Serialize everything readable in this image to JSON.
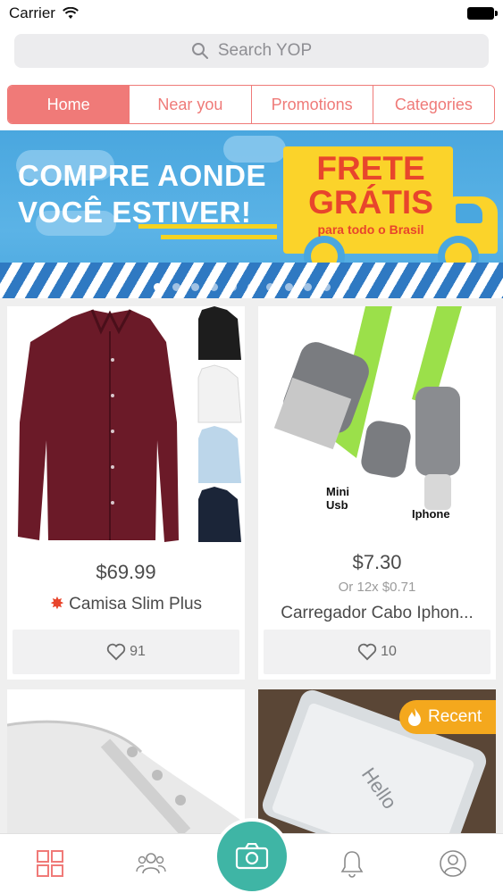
{
  "status_bar": {
    "carrier": "Carrier"
  },
  "search": {
    "placeholder": "Search YOP"
  },
  "tabs": [
    {
      "label": "Home",
      "active": true
    },
    {
      "label": "Near you",
      "active": false
    },
    {
      "label": "Promotions",
      "active": false
    },
    {
      "label": "Categories",
      "active": false
    }
  ],
  "banner": {
    "headline_line1": "COMPRE AONDE",
    "headline_line2": "VOCÊ ESTIVER!",
    "frete_line1": "FRETE",
    "frete_line2": "GRÁTIS",
    "frete_sub": "para todo o Brasil",
    "slide_count": 11,
    "active_slide": 1
  },
  "products": [
    {
      "price": "$69.99",
      "installments": "",
      "title": "Camisa Slim Plus",
      "title_icon": "burst-emoji",
      "likes": "91",
      "image": "burgundy-shirt"
    },
    {
      "price": "$7.30",
      "installments": "Or 12x $0.71",
      "title": "Carregador Cabo Iphon...",
      "likes": "10",
      "image": "usb-cable",
      "image_labels": {
        "mini_usb": "Mini\nUsb",
        "iphone": "Iphone"
      }
    },
    {
      "image": "white-sneaker"
    },
    {
      "image": "iphone-hello-screen",
      "badge": "Recent",
      "badge_icon": "flame-icon",
      "screen_text": "Hello"
    }
  ],
  "tabbar": {
    "items": [
      "grid-icon",
      "people-icon",
      "camera-icon",
      "bell-icon",
      "profile-icon"
    ],
    "active": "grid-icon"
  },
  "colors": {
    "accent": "#f07a78",
    "camera": "#3fb5a5",
    "badge": "#f4a81d",
    "banner_blue": "#4aa7df",
    "banner_yellow": "#fbd32a",
    "banner_red": "#e8452c"
  }
}
